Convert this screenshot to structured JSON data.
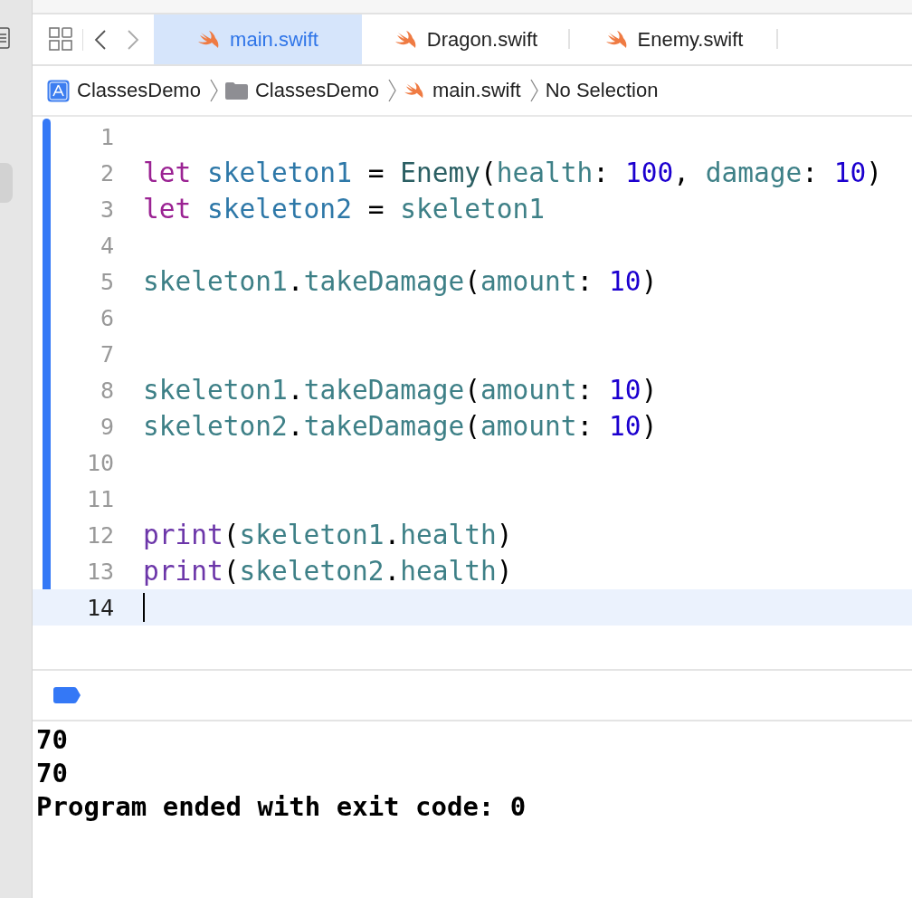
{
  "tabs": [
    {
      "label": "main.swift",
      "selected": true
    },
    {
      "label": "Dragon.swift",
      "selected": false
    },
    {
      "label": "Enemy.swift",
      "selected": false
    }
  ],
  "breadcrumb": [
    {
      "label": "ClassesDemo",
      "kind": "app"
    },
    {
      "label": "ClassesDemo",
      "kind": "folder"
    },
    {
      "label": "main.swift",
      "kind": "swift"
    },
    {
      "label": "No Selection",
      "kind": "plain"
    }
  ],
  "editor": {
    "lines": [
      {
        "number": "1",
        "changed": true,
        "current": false
      },
      {
        "number": "2",
        "changed": true,
        "current": false,
        "tokens": [
          {
            "text": "let ",
            "kind": "keyword"
          },
          {
            "text": "skeleton1",
            "kind": "decl"
          },
          {
            "text": " = ",
            "kind": "plain"
          },
          {
            "text": "Enemy",
            "kind": "type"
          },
          {
            "text": "(",
            "kind": "plain"
          },
          {
            "text": "health",
            "kind": "ident"
          },
          {
            "text": ": ",
            "kind": "plain"
          },
          {
            "text": "100",
            "kind": "number"
          },
          {
            "text": ", ",
            "kind": "plain"
          },
          {
            "text": "damage",
            "kind": "ident"
          },
          {
            "text": ": ",
            "kind": "plain"
          },
          {
            "text": "10",
            "kind": "number"
          },
          {
            "text": ")",
            "kind": "plain"
          }
        ]
      },
      {
        "number": "3",
        "changed": true,
        "current": false,
        "tokens": [
          {
            "text": "let ",
            "kind": "keyword"
          },
          {
            "text": "skeleton2",
            "kind": "decl"
          },
          {
            "text": " = ",
            "kind": "plain"
          },
          {
            "text": "skeleton1",
            "kind": "ident"
          }
        ]
      },
      {
        "number": "4",
        "changed": true,
        "current": false
      },
      {
        "number": "5",
        "changed": true,
        "current": false,
        "tokens": [
          {
            "text": "skeleton1",
            "kind": "ident"
          },
          {
            "text": ".",
            "kind": "plain"
          },
          {
            "text": "takeDamage",
            "kind": "ident"
          },
          {
            "text": "(",
            "kind": "plain"
          },
          {
            "text": "amount",
            "kind": "ident"
          },
          {
            "text": ": ",
            "kind": "plain"
          },
          {
            "text": "10",
            "kind": "number"
          },
          {
            "text": ")",
            "kind": "plain"
          }
        ]
      },
      {
        "number": "6",
        "changed": true,
        "current": false
      },
      {
        "number": "7",
        "changed": true,
        "current": false
      },
      {
        "number": "8",
        "changed": true,
        "current": false,
        "tokens": [
          {
            "text": "skeleton1",
            "kind": "ident"
          },
          {
            "text": ".",
            "kind": "plain"
          },
          {
            "text": "takeDamage",
            "kind": "ident"
          },
          {
            "text": "(",
            "kind": "plain"
          },
          {
            "text": "amount",
            "kind": "ident"
          },
          {
            "text": ": ",
            "kind": "plain"
          },
          {
            "text": "10",
            "kind": "number"
          },
          {
            "text": ")",
            "kind": "plain"
          }
        ]
      },
      {
        "number": "9",
        "changed": true,
        "current": false,
        "tokens": [
          {
            "text": "skeleton2",
            "kind": "ident"
          },
          {
            "text": ".",
            "kind": "plain"
          },
          {
            "text": "takeDamage",
            "kind": "ident"
          },
          {
            "text": "(",
            "kind": "plain"
          },
          {
            "text": "amount",
            "kind": "ident"
          },
          {
            "text": ": ",
            "kind": "plain"
          },
          {
            "text": "10",
            "kind": "number"
          },
          {
            "text": ")",
            "kind": "plain"
          }
        ]
      },
      {
        "number": "10",
        "changed": true,
        "current": false
      },
      {
        "number": "11",
        "changed": true,
        "current": false
      },
      {
        "number": "12",
        "changed": true,
        "current": false,
        "tokens": [
          {
            "text": "print",
            "kind": "function"
          },
          {
            "text": "(",
            "kind": "plain"
          },
          {
            "text": "skeleton1",
            "kind": "ident"
          },
          {
            "text": ".",
            "kind": "plain"
          },
          {
            "text": "health",
            "kind": "ident"
          },
          {
            "text": ")",
            "kind": "plain"
          }
        ]
      },
      {
        "number": "13",
        "changed": true,
        "current": false,
        "tokens": [
          {
            "text": "print",
            "kind": "function"
          },
          {
            "text": "(",
            "kind": "plain"
          },
          {
            "text": "skeleton2",
            "kind": "ident"
          },
          {
            "text": ".",
            "kind": "plain"
          },
          {
            "text": "health",
            "kind": "ident"
          },
          {
            "text": ")",
            "kind": "plain"
          }
        ]
      },
      {
        "number": "14",
        "changed": false,
        "current": true
      }
    ]
  },
  "console": {
    "lines": [
      "70",
      "70",
      "Program ended with exit code: 0"
    ]
  }
}
